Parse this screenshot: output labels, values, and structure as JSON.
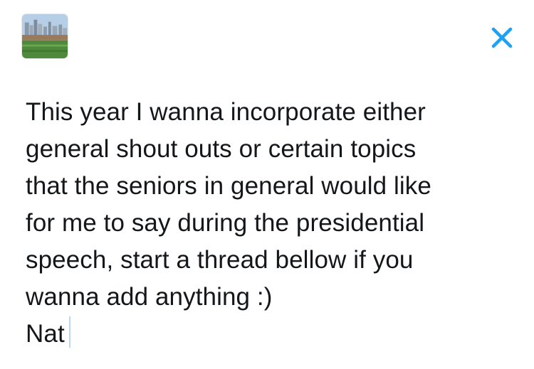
{
  "header": {
    "avatar_icon": "user-avatar-icon",
    "close_icon": "close-icon",
    "accent_color": "#1da1f2"
  },
  "compose": {
    "lines": [
      "This year I wanna incorporate either",
      "general shout outs or certain topics",
      "that the seniors in general would like",
      "for me to say during the presidential",
      "speech, start a thread bellow if you",
      "wanna add anything :)",
      "Nat"
    ]
  }
}
